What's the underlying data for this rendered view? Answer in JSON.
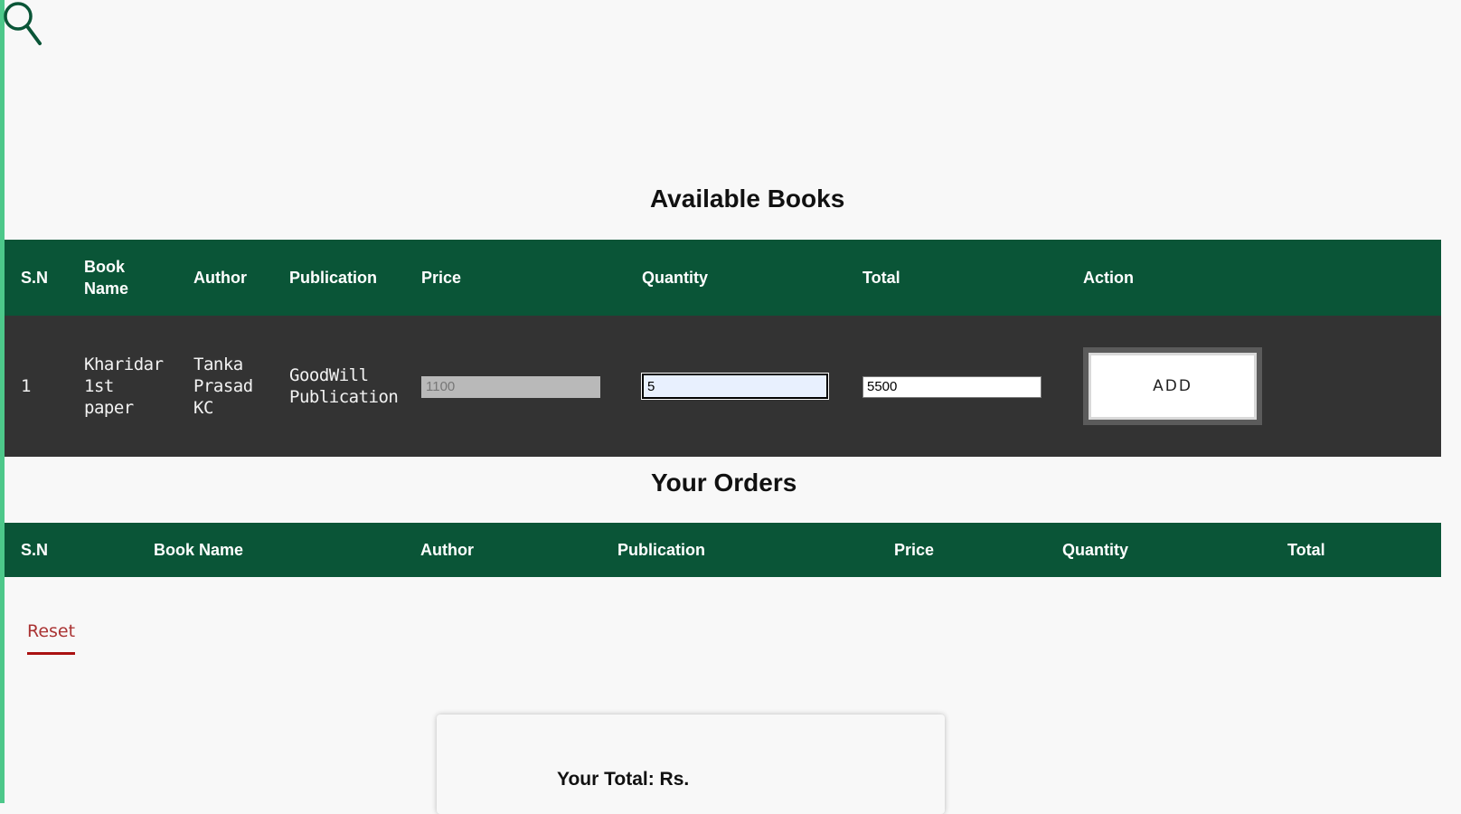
{
  "icons": {
    "search": "search-icon"
  },
  "colors": {
    "header_green": "#0a5537",
    "row_dark": "#333333",
    "accent": "#4dc88a",
    "reset_red": "#a33"
  },
  "available": {
    "title": "Available Books",
    "headers": [
      "S.N",
      "Book Name",
      "Author",
      "Publication",
      "Price",
      "Quantity",
      "Total",
      "Action"
    ],
    "rows": [
      {
        "sn": "1",
        "book_name": "Kharidar 1st paper",
        "author": "Tanka Prasad KC",
        "publication": "GoodWill Publication",
        "price": "1100",
        "quantity": "5",
        "total": "5500",
        "action": "ADD"
      }
    ]
  },
  "orders": {
    "title": "Your Orders",
    "headers": [
      "S.N",
      "Book Name",
      "Author",
      "Publication",
      "Price",
      "Quantity",
      "Total"
    ]
  },
  "reset_label": "Reset",
  "total_label": "Your Total: Rs."
}
